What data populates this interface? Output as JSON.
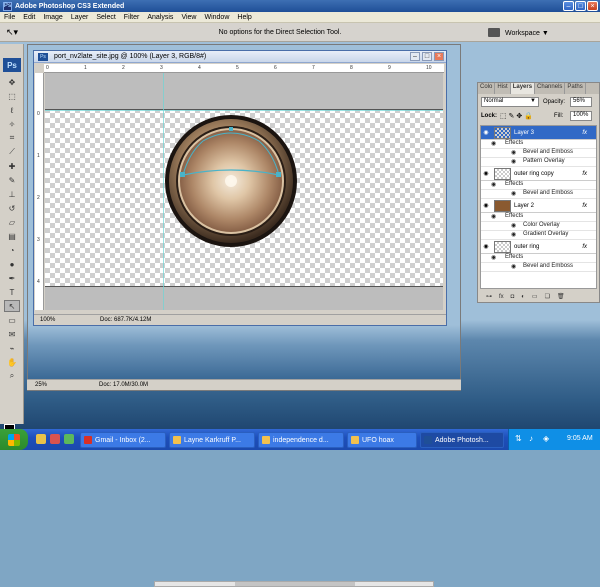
{
  "app": {
    "title": "Adobe Photoshop CS3 Extended",
    "logo": "Ps"
  },
  "menu": [
    "File",
    "Edit",
    "Image",
    "Layer",
    "Select",
    "Filter",
    "Analysis",
    "View",
    "Window",
    "Help"
  ],
  "options": {
    "message": "No options for the Direct Selection Tool.",
    "workspace": "Workspace"
  },
  "back_document": {
    "zoom": "25%",
    "doc_size": "Doc: 17.0M/30.0M"
  },
  "document": {
    "title": "port_nv2late_site.jpg @ 100% (Layer 3, RGB/8#)",
    "zoom": "100%",
    "doc_size": "Doc: 687.7K/4.12M",
    "ruler_top": [
      "0",
      "1",
      "2",
      "3",
      "4",
      "5",
      "6",
      "7",
      "8",
      "9",
      "10"
    ],
    "ruler_left": [
      "0",
      "1",
      "2",
      "3",
      "4"
    ]
  },
  "layers_panel": {
    "tabs": [
      "Colo",
      "Hist",
      "Layers",
      "Channels",
      "Paths"
    ],
    "blend_mode": "Normal",
    "opacity_label": "Opacity:",
    "opacity": "56%",
    "lock_label": "Lock:",
    "fill_label": "Fill:",
    "fill": "100%",
    "layers": [
      {
        "name": "Layer 3",
        "selected": true,
        "effects_label": "Effects",
        "effects": [
          "Bevel and Emboss",
          "Pattern Overlay"
        ]
      },
      {
        "name": "outer ring copy",
        "selected": false,
        "effects_label": "Effects",
        "effects": [
          "Bevel and Emboss"
        ]
      },
      {
        "name": "Layer 2",
        "selected": false,
        "effects_label": "Effects",
        "effects": [
          "Color Overlay",
          "Gradient Overlay"
        ]
      },
      {
        "name": "outer ring",
        "selected": false,
        "effects_label": "Effects",
        "effects": [
          "Bevel and Emboss"
        ]
      }
    ],
    "fx_label": "fx"
  },
  "taskbar": {
    "items": [
      {
        "label": "Gmail - Inbox (2...",
        "color": "#d93025"
      },
      {
        "label": "Layne Karkruff P...",
        "color": "#f2c14e"
      },
      {
        "label": "independence d...",
        "color": "#f2c14e"
      },
      {
        "label": "UFO hoax",
        "color": "#f2c14e"
      },
      {
        "label": "Adobe Photosh...",
        "color": "#1f4f97"
      }
    ],
    "clock": "9:05 AM"
  }
}
